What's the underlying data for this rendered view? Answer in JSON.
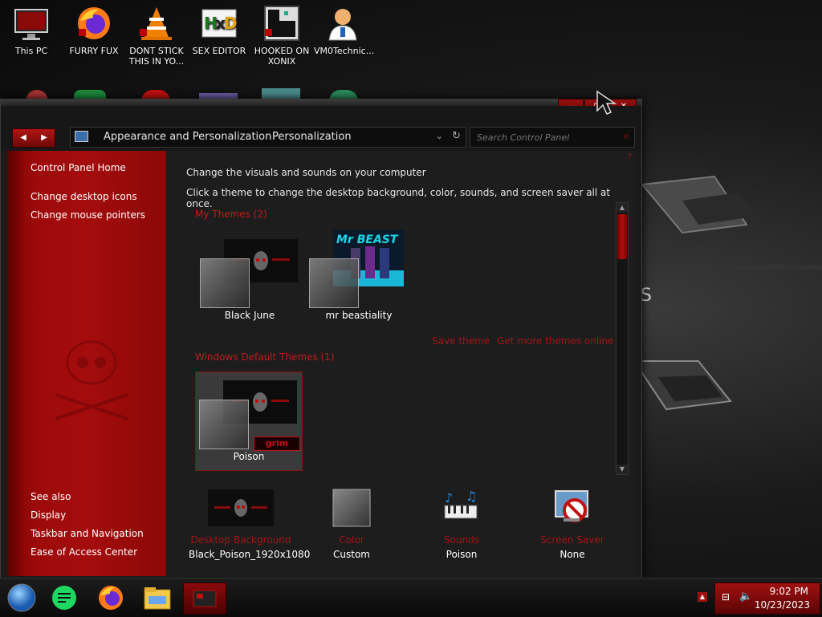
{
  "desktop": {
    "icons": [
      {
        "label": "This PC",
        "icon": "monitor-icon"
      },
      {
        "label": "FURRY FUX",
        "icon": "firefox-icon"
      },
      {
        "label": "DONT STICK THIS IN YO...",
        "icon": "vlc-cone-icon"
      },
      {
        "label": "SEX EDITOR",
        "icon": "hxd-editor-icon"
      },
      {
        "label": "HOOKED ON XONIX",
        "icon": "xonix-game-icon"
      },
      {
        "label": "VM0Technic...",
        "icon": "technician-user-icon"
      }
    ]
  },
  "window": {
    "address": {
      "crumb1": "Appearance and Personalization",
      "crumb2": "Personalization"
    },
    "search": {
      "placeholder": "Search Control Panel"
    },
    "sidebar": {
      "home": "Control Panel Home",
      "links": [
        "Change desktop icons",
        "Change mouse pointers"
      ],
      "see_also_title": "See also",
      "see_also": [
        "Display",
        "Taskbar and Navigation",
        "Ease of Access Center"
      ]
    },
    "content": {
      "headline": "Change the visuals and sounds on your computer",
      "subline": "Click a theme to change the desktop background, color, sounds, and screen saver all at once.",
      "my_themes_title": "My Themes (2)",
      "my_themes": [
        {
          "name": "Black June"
        },
        {
          "name": "mr beastiality",
          "overlay_text": "Mr BEAST"
        }
      ],
      "save_theme": "Save theme",
      "get_more": "Get more themes online",
      "default_themes_title": "Windows Default Themes (1)",
      "default_themes": [
        {
          "name": "Poison",
          "badge": "grim"
        }
      ],
      "bottom": [
        {
          "label": "Desktop Background",
          "value": "Black_Poison_1920x1080",
          "icon": "desktop-background-icon"
        },
        {
          "label": "Color",
          "value": "Custom",
          "icon": "color-swatch-icon"
        },
        {
          "label": "Sounds",
          "value": "Poison",
          "icon": "sounds-icon"
        },
        {
          "label": "Screen Saver",
          "value": "None",
          "icon": "screen-saver-icon"
        }
      ]
    }
  },
  "taskbar": {
    "time": "9:02 PM",
    "date": "10/23/2023"
  },
  "colors": {
    "accent": "#a00c0c",
    "link_red": "#a11515",
    "window_bg": "#1d1d1d"
  }
}
